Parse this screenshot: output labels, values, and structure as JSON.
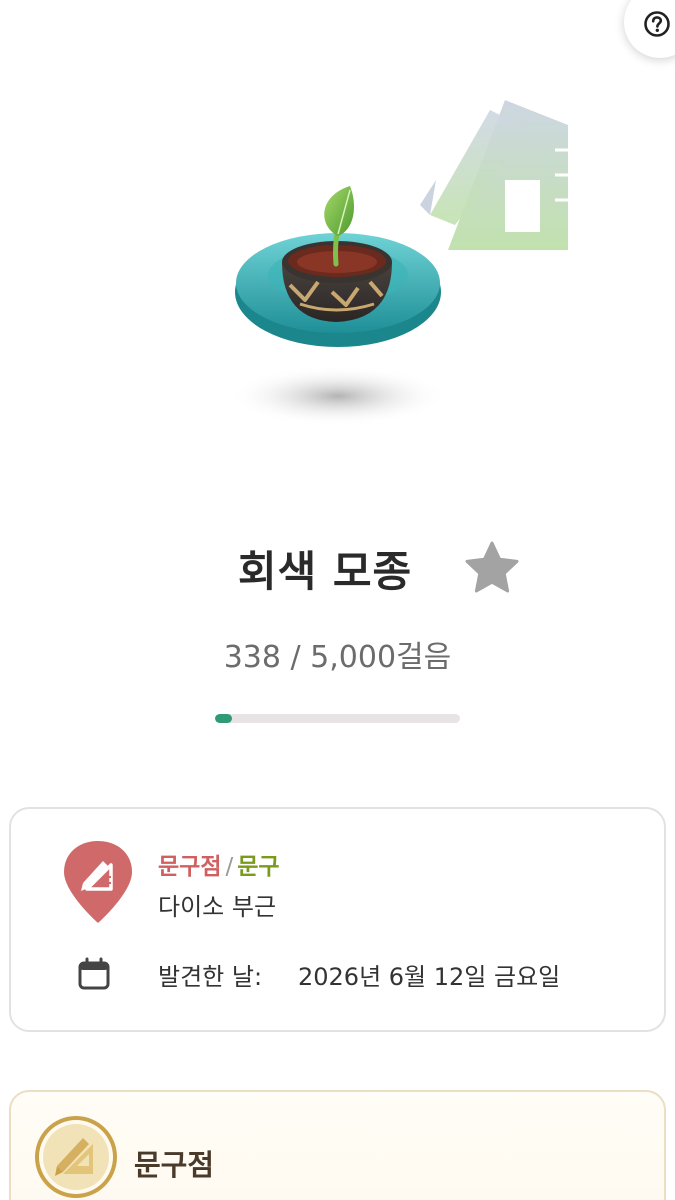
{
  "header": {
    "help_icon": "question-circle-icon"
  },
  "item": {
    "name": "회색 모종",
    "favorite_icon": "star-icon",
    "steps_current": "338",
    "steps_separator": " / ",
    "steps_goal": "5,000걸음",
    "progress": 0.068
  },
  "info_card": {
    "category_main": "문구점",
    "category_separator": "/",
    "category_sub": "문구",
    "location": "다이소 부근",
    "found_label": "발견한 날:",
    "found_date": "2026년 6월 12일 금요일"
  },
  "shop_card": {
    "name": "문구점"
  },
  "colors": {
    "accent_green": "#2f9a78",
    "category_red": "#d06060",
    "category_green": "#7a9a1c",
    "pin_red": "#d06a6a"
  }
}
